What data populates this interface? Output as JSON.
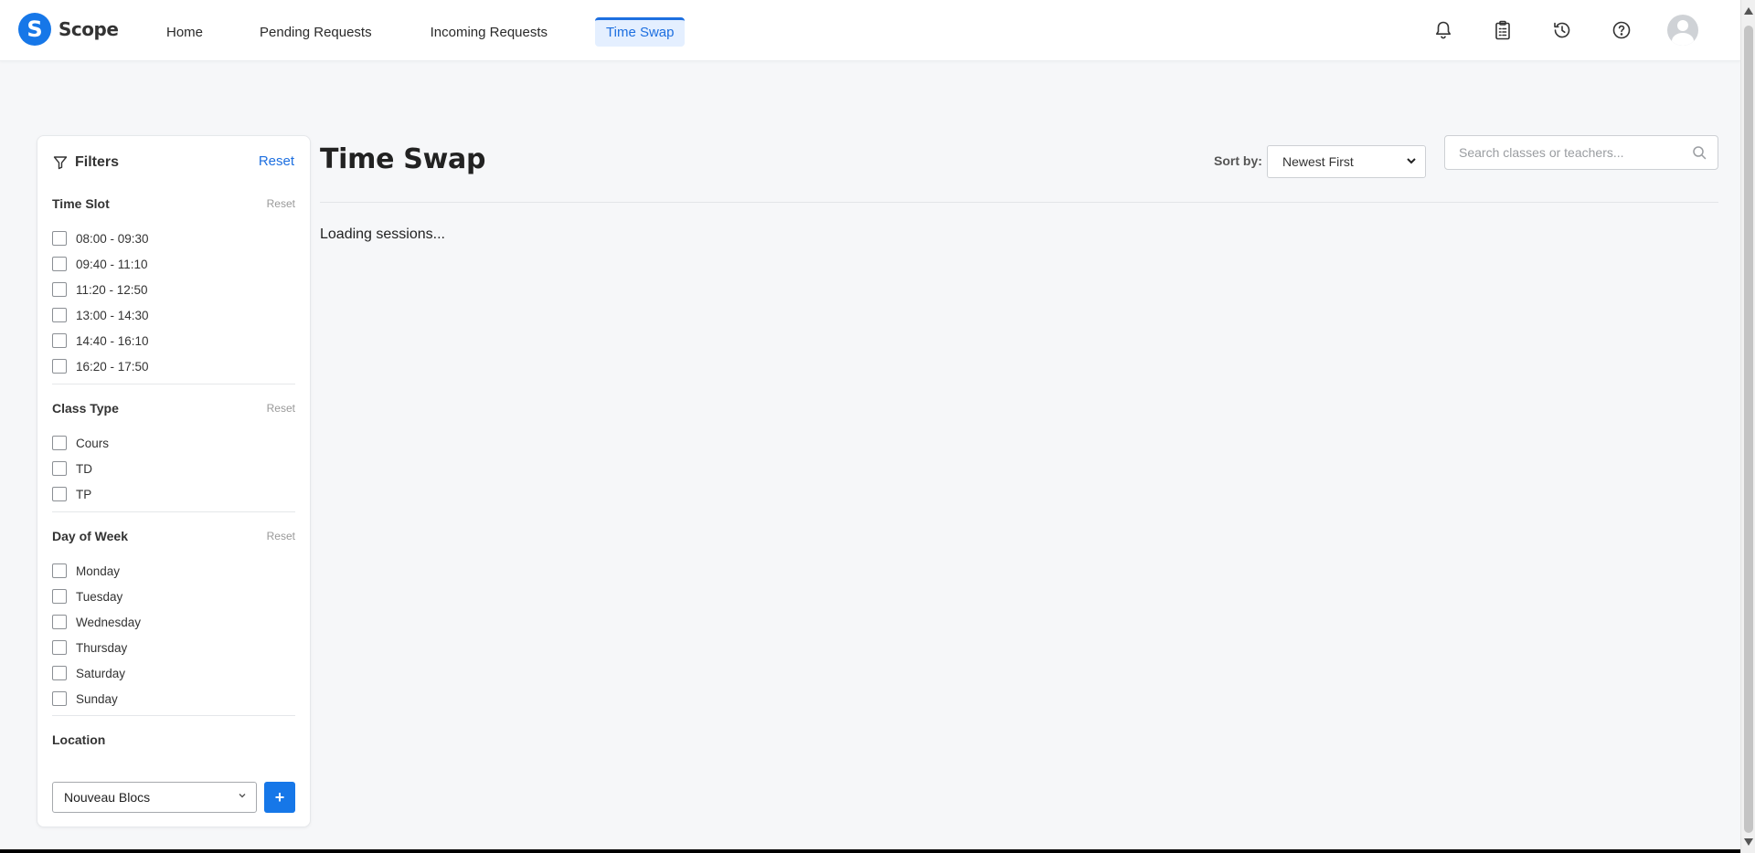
{
  "app": {
    "logo_letter": "S",
    "name": "Scope",
    "brand_color": "#1677e8"
  },
  "nav": {
    "items": [
      {
        "label": "Home"
      },
      {
        "label": "Pending Requests"
      },
      {
        "label": "Incoming Requests"
      },
      {
        "label": "Time Swap",
        "active": true
      }
    ]
  },
  "header_icons": [
    "bell-icon",
    "clipboard-icon",
    "history-icon",
    "help-icon",
    "avatar"
  ],
  "filters": {
    "title": "Filters",
    "reset_label": "Reset",
    "sections": [
      {
        "title": "Time Slot",
        "reset_label": "Reset",
        "options": [
          {
            "label": "08:00 - 09:30",
            "checked": false
          },
          {
            "label": "09:40 - 11:10",
            "checked": false
          },
          {
            "label": "11:20 - 12:50",
            "checked": false
          },
          {
            "label": "13:00 - 14:30",
            "checked": false
          },
          {
            "label": "14:40 - 16:10",
            "checked": false
          },
          {
            "label": "16:20 - 17:50",
            "checked": false
          }
        ]
      },
      {
        "title": "Class Type",
        "reset_label": "Reset",
        "options": [
          {
            "label": "Cours",
            "checked": false
          },
          {
            "label": "TD",
            "checked": false
          },
          {
            "label": "TP",
            "checked": false
          }
        ]
      },
      {
        "title": "Day of Week",
        "reset_label": "Reset",
        "options": [
          {
            "label": "Monday",
            "checked": false
          },
          {
            "label": "Tuesday",
            "checked": false
          },
          {
            "label": "Wednesday",
            "checked": false
          },
          {
            "label": "Thursday",
            "checked": false
          },
          {
            "label": "Saturday",
            "checked": false
          },
          {
            "label": "Sunday",
            "checked": false
          }
        ]
      }
    ],
    "location": {
      "title": "Location",
      "selected": "Nouveau Blocs",
      "add_label": "+"
    }
  },
  "main": {
    "title": "Time Swap",
    "sort_label": "Sort by:",
    "sort_selected": "Newest First",
    "search_placeholder": "Search classes or teachers...",
    "loading_text": "Loading sessions..."
  }
}
